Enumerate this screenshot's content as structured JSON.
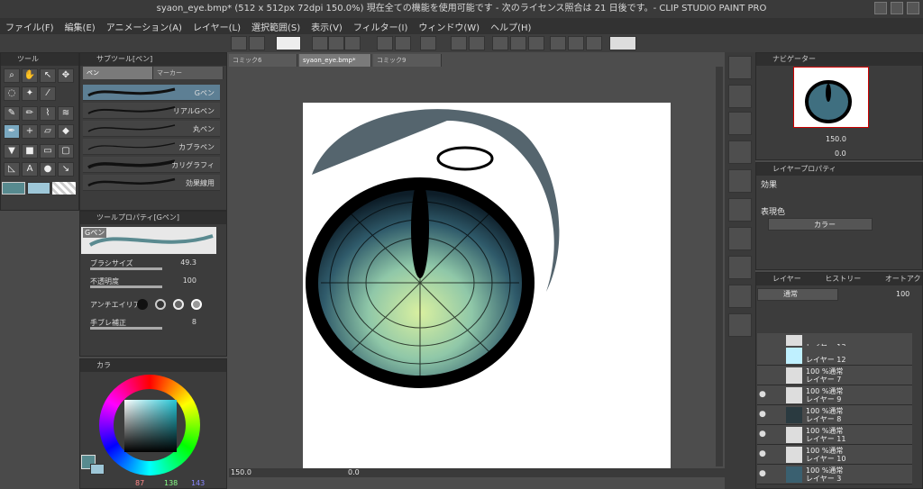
{
  "window": {
    "title": "syaon_eye.bmp* (512 x 512px 72dpi 150.0%)  現在全ての機能を使用可能です - 次のライセンス照合は 21 日後です。- CLIP STUDIO PAINT PRO"
  },
  "menu": [
    "ファイル(F)",
    "編集(E)",
    "アニメーション(A)",
    "レイヤー(L)",
    "選択範囲(S)",
    "表示(V)",
    "フィルター(I)",
    "ウィンドウ(W)",
    "ヘルプ(H)"
  ],
  "tool_panel": {
    "title": "ツール"
  },
  "subtool_panel": {
    "title": "サブツール[ペン]",
    "tabs": [
      "ペン",
      "マーカー"
    ],
    "brushes": [
      "Gペン",
      "リアルGペン",
      "丸ペン",
      "カブラペン",
      "カリグラフィ",
      "効果線用"
    ]
  },
  "toolprop": {
    "title": "ツールプロパティ[Gペン]",
    "brush_name": "Gペン",
    "brush_size_label": "ブラシサイズ",
    "brush_size_value": "49.3",
    "opacity_label": "不透明度",
    "opacity_value": "100",
    "antialias_label": "アンチエイリアス",
    "stabilization_label": "手ブレ補正",
    "stabilization_value": "8"
  },
  "color_panel": {
    "tab": "カラ",
    "r": "87",
    "g": "138",
    "b": "143",
    "main_color": "#578a8f",
    "sub_color": "#9ec7d8"
  },
  "canvas": {
    "tabs": [
      "コミック6",
      "syaon_eye.bmp*",
      "コミック9"
    ],
    "zoom": "150.0",
    "coord": "0.0"
  },
  "navigator": {
    "title": "ナビゲーター",
    "zoom": "150.0",
    "angle": "0.0"
  },
  "layer_prop": {
    "title": "レイヤープロパティ",
    "effect_label": "効果",
    "expr_label": "表現色",
    "expr_value": "カラー"
  },
  "layers": {
    "tabs": [
      "レイヤー",
      "ヒストリー",
      "オートアクション"
    ],
    "blend": "通常",
    "opacity": "100",
    "items": [
      {
        "top": "",
        "name": "レイヤー 13",
        "eye": false
      },
      {
        "top": "",
        "name": "レイヤー 12",
        "eye": false
      },
      {
        "top": "100 %通常",
        "name": "レイヤー 7",
        "eye": false
      },
      {
        "top": "100 %通常",
        "name": "レイヤー 9",
        "eye": true
      },
      {
        "top": "100 %通常",
        "name": "レイヤー 8",
        "eye": true
      },
      {
        "top": "100 %通常",
        "name": "レイヤー 11",
        "eye": true
      },
      {
        "top": "100 %通常",
        "name": "レイヤー 10",
        "eye": true
      },
      {
        "top": "100 %通常",
        "name": "レイヤー 3",
        "eye": true
      }
    ]
  }
}
